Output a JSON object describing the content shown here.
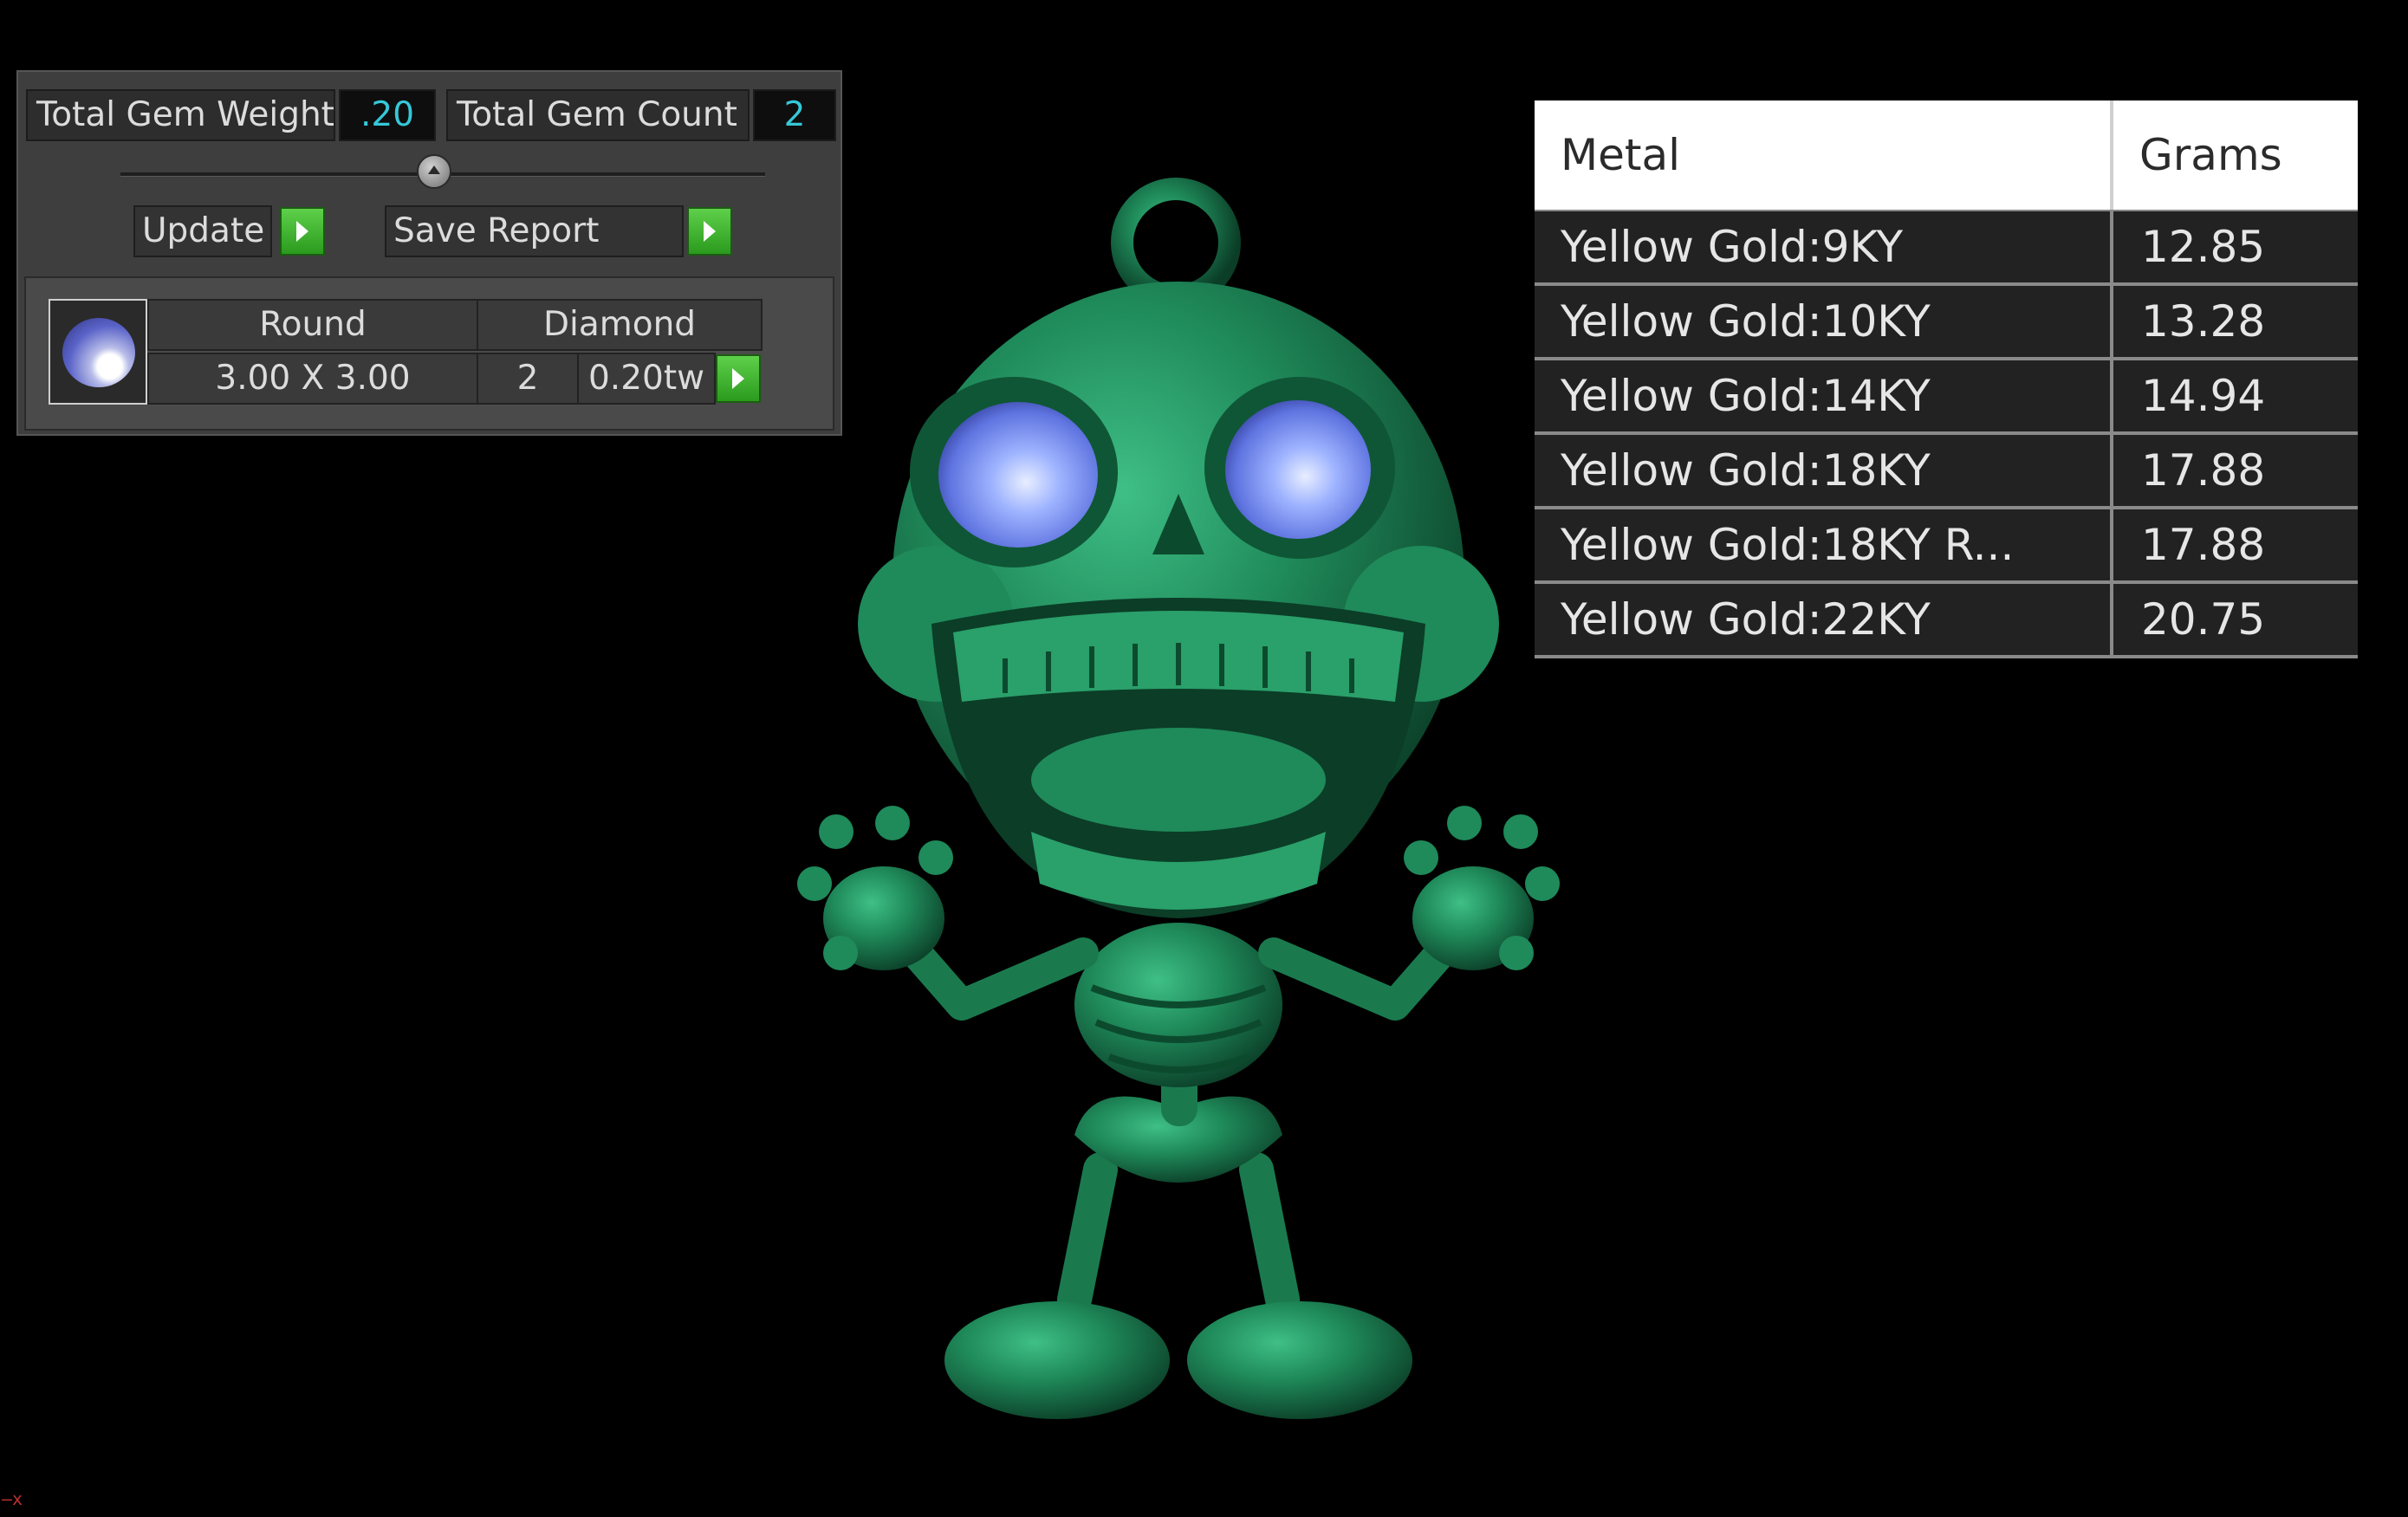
{
  "gem_panel": {
    "total_gem_weight_label": "Total Gem Weight",
    "total_gem_weight_value": ".20",
    "total_gem_count_label": "Total Gem Count",
    "total_gem_count_value": "2",
    "update_label": "Update",
    "save_report_label": "Save Report",
    "gem": {
      "shape": "Round",
      "type": "Diamond",
      "size": "3.00 X 3.00",
      "count": "2",
      "weight": "0.20tw"
    }
  },
  "metal_table": {
    "header_metal": "Metal",
    "header_grams": "Grams",
    "rows": [
      {
        "metal": "Yellow Gold:9KY",
        "grams": "12.85"
      },
      {
        "metal": "Yellow Gold:10KY",
        "grams": "13.28"
      },
      {
        "metal": "Yellow Gold:14KY",
        "grams": "14.94"
      },
      {
        "metal": "Yellow Gold:18KY",
        "grams": "17.88"
      },
      {
        "metal": "Yellow Gold:18KY R...",
        "grams": "17.88"
      },
      {
        "metal": "Yellow Gold:22KY",
        "grams": "20.75"
      }
    ]
  },
  "viewport": {
    "model_color": "#1f8a5a",
    "gem_color": "#6e8ff0",
    "corner_mark": "—x"
  }
}
